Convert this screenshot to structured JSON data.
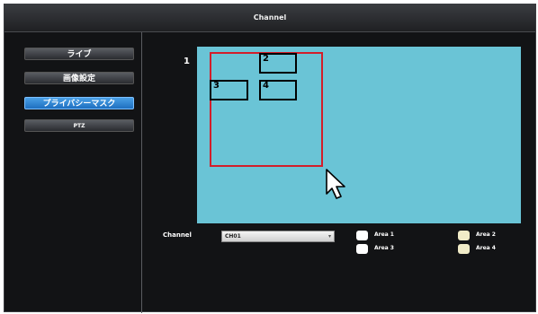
{
  "window": {
    "title": "Channel"
  },
  "sidebar": {
    "items": [
      {
        "label": "ライブ",
        "active": false
      },
      {
        "label": "画像設定",
        "active": false
      },
      {
        "label": "プライバシーマスク",
        "active": true
      },
      {
        "label": "PTZ",
        "active": false
      }
    ]
  },
  "preview": {
    "label_1": "1",
    "areas": [
      {
        "label": "2"
      },
      {
        "label": "3"
      },
      {
        "label": "4"
      }
    ]
  },
  "channel": {
    "label": "Channel",
    "selected": "CH01"
  },
  "areas_checkboxes": [
    {
      "label": "Area 1",
      "color": "#ffffff"
    },
    {
      "label": "Area 2",
      "color": "#f1ecc8"
    },
    {
      "label": "Area 3",
      "color": "#ffffff"
    },
    {
      "label": "Area 4",
      "color": "#f1ecc8"
    }
  ],
  "colors": {
    "background": "#121315",
    "preview": "#6ac4d6",
    "selection": "#d21e2a",
    "accent": "#2a82d4"
  }
}
